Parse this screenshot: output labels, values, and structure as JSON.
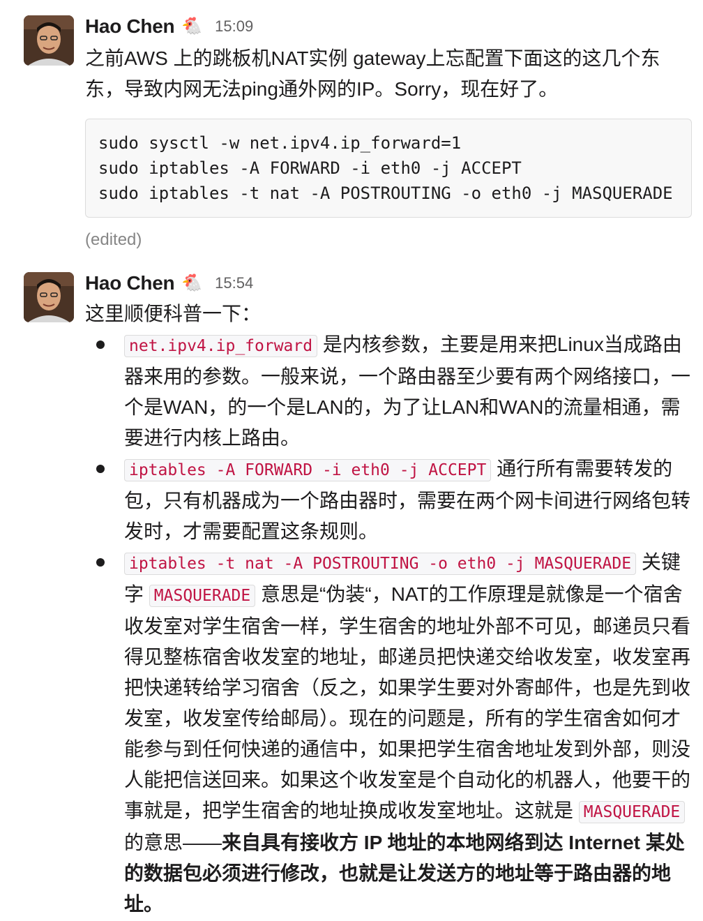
{
  "messages": [
    {
      "author": "Hao Chen",
      "emoji": "🐔",
      "time": "15:09",
      "text": "之前AWS 上的跳板机NAT实例 gateway上忘配置下面这的这几个东东，导致内网无法ping通外网的IP。Sorry，现在好了。",
      "code_lines": [
        "sudo sysctl -w net.ipv4.ip_forward=1",
        "sudo iptables -A FORWARD -i eth0 -j ACCEPT",
        "sudo iptables -t nat -A POSTROUTING -o eth0 -j MASQUERADE"
      ],
      "edited": "(edited)"
    },
    {
      "author": "Hao Chen",
      "emoji": "🐔",
      "time": "15:54",
      "text": "这里顺便科普一下：",
      "bullets": [
        {
          "code": "net.ipv4.ip_forward",
          "text": " 是内核参数，主要是用来把Linux当成路由器来用的参数。一般来说，一个路由器至少要有两个网络接口，一个是WAN，的一个是LAN的，为了让LAN和WAN的流量相通，需要进行内核上路由。"
        },
        {
          "code": "iptables -A FORWARD -i eth0 -j ACCEPT",
          "text": " 通行所有需要转发的包，只有机器成为一个路由器时，需要在两个网卡间进行网络包转发时，才需要配置这条规则。"
        },
        {
          "code": "iptables -t nat -A POSTROUTING -o eth0 -j MASQUERADE",
          "text1": "  关键字 ",
          "code2": "MASQUERADE",
          "text2": " 意思是“伪装“，NAT的工作原理是就像是一个宿舍收发室对学生宿舍一样，学生宿舍的地址外部不可见，邮递员只看得见整栋宿舍收发室的地址，邮递员把快递交给收发室，收发室再把快递转给学习宿舍（反之，如果学生要对外寄邮件，也是先到收发室，收发室传给邮局）。现在的问题是，所有的学生宿舍如何才能参与到任何快递的通信中，如果把学生宿舍地址发到外部，则没人能把信送回来。如果这个收发室是个自动化的机器人，他要干的事就是，把学生宿舍的地址换成收发室地址。这就是 ",
          "code3": "MASQUERADE",
          "text3": " 的意思——",
          "bold": "来自具有接收方 IP 地址的本地网络到达 Internet 某处的数据包必须进行修改，也就是让发送方的地址等于路由器的地址。"
        }
      ]
    }
  ]
}
